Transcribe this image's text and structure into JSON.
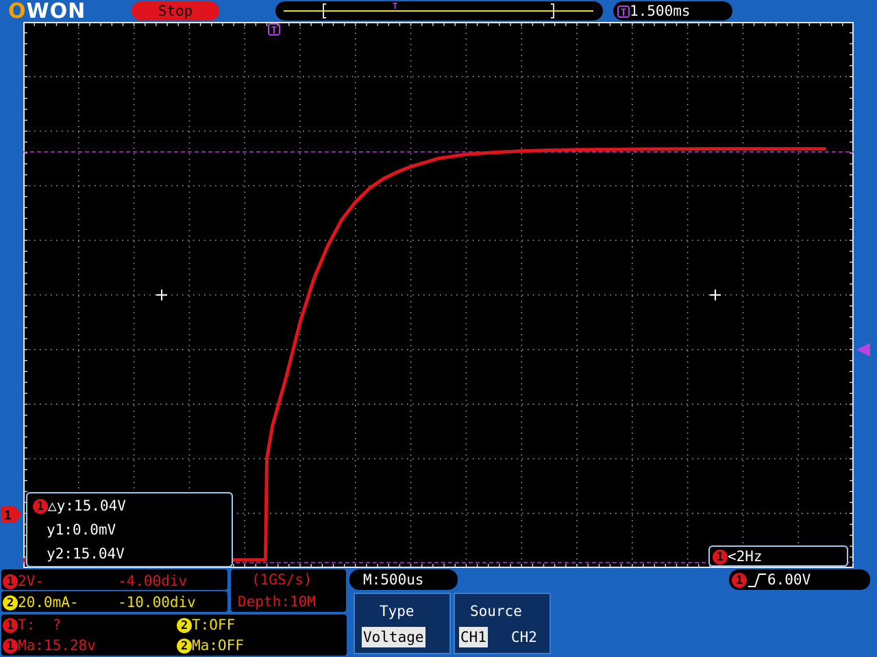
{
  "header": {
    "logo": "OWON",
    "run_state": "Stop",
    "trigger_marker": "T",
    "trigger_delay": "1.500ms"
  },
  "screen": {
    "trigger_position_marker": "T",
    "channel_marker": "1",
    "cursor_box": {
      "channel": "1",
      "delta_label": "△y:15.04V",
      "y1_label": "y1:0.0mV",
      "y2_label": "y2:15.04V"
    },
    "freq_box": {
      "channel": "1",
      "value": "<2Hz"
    }
  },
  "footer": {
    "ch1": {
      "badge": "1",
      "scale": "2V-",
      "offset": "-4.00div"
    },
    "ch2": {
      "badge": "2",
      "scale": "20.0mA-",
      "offset": "-10.00div"
    },
    "sample_rate": "(1GS/s)",
    "depth": "Depth:10M",
    "timebase": "M:500us",
    "trigger": {
      "badge": "1",
      "level": "6.00V"
    },
    "meas": {
      "r1_badge": "1",
      "r1_label": "T:  ?",
      "r1b_badge": "2",
      "r1b_label": "T:OFF",
      "r2_badge": "1",
      "r2_label": "Ma:15.28v",
      "r2b_badge": "2",
      "r2b_label": "Ma:OFF"
    },
    "menu": {
      "type_title": "Type",
      "type_value": "Voltage",
      "source_title": "Source",
      "source_ch1": "CH1",
      "source_ch2": "CH2"
    }
  },
  "colors": {
    "ch1": "#e0141c",
    "ch2": "#f0e000",
    "cursor": "#b030d0",
    "background": "#1a64c0"
  },
  "chart_data": {
    "type": "line",
    "title": "",
    "xlabel": "",
    "ylabel": "",
    "x_unit": "ms",
    "y_unit": "V",
    "xlim": [
      -1.0,
      5.0
    ],
    "ylim": [
      -8.0,
      12.0
    ],
    "grid": true,
    "series": [
      {
        "name": "CH1",
        "x": [
          -1.0,
          0.3,
          0.75,
          0.76,
          0.8,
          0.9,
          1.0,
          1.1,
          1.2,
          1.3,
          1.4,
          1.5,
          1.6,
          1.7,
          1.8,
          2.0,
          2.2,
          2.4,
          2.6,
          2.8,
          3.0,
          3.5,
          4.0,
          4.5,
          4.8
        ],
        "y": [
          -7.7,
          -7.7,
          -7.7,
          -4.0,
          -2.8,
          -1.0,
          1.0,
          2.6,
          3.8,
          4.75,
          5.4,
          5.9,
          6.25,
          6.5,
          6.7,
          7.0,
          7.15,
          7.22,
          7.27,
          7.3,
          7.32,
          7.34,
          7.35,
          7.35,
          7.35
        ]
      }
    ],
    "cursors": {
      "y1": -7.8,
      "y2": 7.24
    }
  }
}
